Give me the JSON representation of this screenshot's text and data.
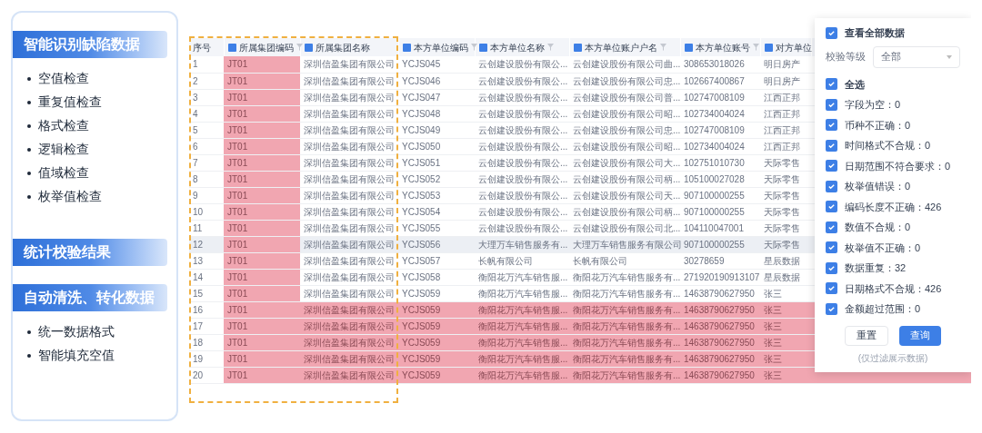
{
  "features": {
    "sections": [
      {
        "title": "智能识别缺陷数据",
        "items": [
          "空值检查",
          "重复值检查",
          "格式检查",
          "逻辑检查",
          "值域检查",
          "枚举值检查"
        ]
      },
      {
        "title": "统计校验结果"
      },
      {
        "title": "自动清洗、转化数据",
        "items": [
          "统一数据格式",
          "智能填充空值"
        ]
      }
    ]
  },
  "table": {
    "columns": [
      {
        "label": "序号",
        "typed": false,
        "filter": false,
        "flagged": false
      },
      {
        "label": "所属集团编码",
        "typed": true,
        "filter": true,
        "flagged": true
      },
      {
        "label": "所属集团名称",
        "typed": true,
        "filter": false,
        "flagged": false
      },
      {
        "label": "本方单位编码",
        "typed": true,
        "filter": true,
        "flagged": false
      },
      {
        "label": "本方单位名称",
        "typed": true,
        "filter": true,
        "flagged": false
      },
      {
        "label": "本方单位账户户名",
        "typed": true,
        "filter": true,
        "flagged": false
      },
      {
        "label": "本方单位账号",
        "typed": true,
        "filter": true,
        "flagged": false
      },
      {
        "label": "对方单位",
        "typed": true,
        "filter": false,
        "flagged": false
      }
    ],
    "rows": [
      {
        "flagged": false,
        "hovered": false,
        "cells": [
          "1",
          "JT01",
          "深圳信盈集团有限公司",
          "YCJS045",
          "云创建设股份有限公...",
          "云创建设股份有限公司曲...",
          "308653018026",
          "明日房产"
        ]
      },
      {
        "flagged": false,
        "hovered": false,
        "cells": [
          "2",
          "JT01",
          "深圳信盈集团有限公司",
          "YCJS046",
          "云创建设股份有限公...",
          "云创建设股份有限公司忠...",
          "102667400867",
          "明日房产"
        ]
      },
      {
        "flagged": false,
        "hovered": false,
        "cells": [
          "3",
          "JT01",
          "深圳信盈集团有限公司",
          "YCJS047",
          "云创建设股份有限公...",
          "云创建设股份有限公司普...",
          "102747008109",
          "江西正邦"
        ]
      },
      {
        "flagged": false,
        "hovered": false,
        "cells": [
          "4",
          "JT01",
          "深圳信盈集团有限公司",
          "YCJS048",
          "云创建设股份有限公...",
          "云创建设股份有限公司昭...",
          "102734004024",
          "江西正邦"
        ]
      },
      {
        "flagged": false,
        "hovered": false,
        "cells": [
          "5",
          "JT01",
          "深圳信盈集团有限公司",
          "YCJS049",
          "云创建设股份有限公...",
          "云创建设股份有限公司忠...",
          "102747008109",
          "江西正邦"
        ]
      },
      {
        "flagged": false,
        "hovered": false,
        "cells": [
          "6",
          "JT01",
          "深圳信盈集团有限公司",
          "YCJS050",
          "云创建设股份有限公...",
          "云创建设股份有限公司昭...",
          "102734004024",
          "江西正邦"
        ]
      },
      {
        "flagged": false,
        "hovered": false,
        "cells": [
          "7",
          "JT01",
          "深圳信盈集团有限公司",
          "YCJS051",
          "云创建设股份有限公...",
          "云创建设股份有限公司大...",
          "102751010730",
          "天际零售"
        ]
      },
      {
        "flagged": false,
        "hovered": false,
        "cells": [
          "8",
          "JT01",
          "深圳信盈集团有限公司",
          "YCJS052",
          "云创建设股份有限公...",
          "云创建设股份有限公司柄...",
          "105100027028",
          "天际零售"
        ]
      },
      {
        "flagged": false,
        "hovered": false,
        "cells": [
          "9",
          "JT01",
          "深圳信盈集团有限公司",
          "YCJS053",
          "云创建设股份有限公...",
          "云创建设股份有限公司天...",
          "907100000255",
          "天际零售"
        ]
      },
      {
        "flagged": false,
        "hovered": false,
        "cells": [
          "10",
          "JT01",
          "深圳信盈集团有限公司",
          "YCJS054",
          "云创建设股份有限公...",
          "云创建设股份有限公司柄...",
          "907100000255",
          "天际零售"
        ]
      },
      {
        "flagged": false,
        "hovered": false,
        "cells": [
          "11",
          "JT01",
          "深圳信盈集团有限公司",
          "YCJS055",
          "云创建设股份有限公...",
          "云创建设股份有限公司北...",
          "104110047001",
          "天际零售"
        ]
      },
      {
        "flagged": false,
        "hovered": true,
        "cells": [
          "12",
          "JT01",
          "深圳信盈集团有限公司",
          "YCJS056",
          "大理万车销售服务有...",
          "大理万车销售服务有限公司",
          "907100000255",
          "天际零售"
        ]
      },
      {
        "flagged": false,
        "hovered": false,
        "cells": [
          "13",
          "JT01",
          "深圳信盈集团有限公司",
          "YCJS057",
          "长帆有限公司",
          "长帆有限公司",
          "30278659",
          "星辰数据"
        ]
      },
      {
        "flagged": false,
        "hovered": false,
        "cells": [
          "14",
          "JT01",
          "深圳信盈集团有限公司",
          "YCJS058",
          "衡阳花万汽车销售服...",
          "衡阳花万汽车销售服务有...",
          "271920190913107",
          "星辰数据"
        ]
      },
      {
        "flagged": false,
        "hovered": false,
        "cells": [
          "15",
          "JT01",
          "深圳信盈集团有限公司",
          "YCJS059",
          "衡阳花万汽车销售服...",
          "衡阳花万汽车销售服务有...",
          "14638790627950",
          "张三"
        ]
      },
      {
        "flagged": true,
        "hovered": false,
        "cells": [
          "16",
          "JT01",
          "深圳信盈集团有限公司",
          "YCJS059",
          "衡阳花万汽车销售服...",
          "衡阳花万汽车销售服务有...",
          "14638790627950",
          "张三"
        ]
      },
      {
        "flagged": true,
        "hovered": false,
        "cells": [
          "17",
          "JT01",
          "深圳信盈集团有限公司",
          "YCJS059",
          "衡阳花万汽车销售服...",
          "衡阳花万汽车销售服务有...",
          "14638790627950",
          "张三"
        ]
      },
      {
        "flagged": true,
        "hovered": false,
        "cells": [
          "18",
          "JT01",
          "深圳信盈集团有限公司",
          "YCJS059",
          "衡阳花万汽车销售服...",
          "衡阳花万汽车销售服务有...",
          "14638790627950",
          "张三"
        ]
      },
      {
        "flagged": true,
        "hovered": false,
        "cells": [
          "19",
          "JT01",
          "深圳信盈集团有限公司",
          "YCJS059",
          "衡阳花万汽车销售服...",
          "衡阳花万汽车销售服务有...",
          "14638790627950",
          "张三"
        ]
      },
      {
        "flagged": true,
        "hovered": false,
        "cells": [
          "20",
          "JT01",
          "深圳信盈集团有限公司",
          "YCJS059",
          "衡阳花万汽车销售服...",
          "衡阳花万汽车销售服务有...",
          "14638790627950",
          "张三"
        ]
      }
    ]
  },
  "filter_panel": {
    "view_all": {
      "label": "查看全部数据",
      "checked": true
    },
    "level": {
      "label": "校验等级",
      "value": "全部"
    },
    "select_all": {
      "label": "全选",
      "checked": true
    },
    "checks": [
      {
        "label": "字段为空：0",
        "checked": true
      },
      {
        "label": "币种不正确：0",
        "checked": true
      },
      {
        "label": "时间格式不合规：0",
        "checked": true
      },
      {
        "label": "日期范围不符合要求：0",
        "checked": true
      },
      {
        "label": "枚举值错误：0",
        "checked": true
      },
      {
        "label": "编码长度不正确：426",
        "checked": true
      },
      {
        "label": "数值不合规：0",
        "checked": true
      },
      {
        "label": "枚举值不正确：0",
        "checked": true
      },
      {
        "label": "数据重复：32",
        "checked": true
      },
      {
        "label": "日期格式不合规：426",
        "checked": true
      },
      {
        "label": "金额超过范围：0",
        "checked": true
      }
    ],
    "buttons": [
      {
        "label": "重置",
        "primary": false
      },
      {
        "label": "查询",
        "primary": true
      }
    ],
    "note": "(仅过滤展示数据)"
  }
}
